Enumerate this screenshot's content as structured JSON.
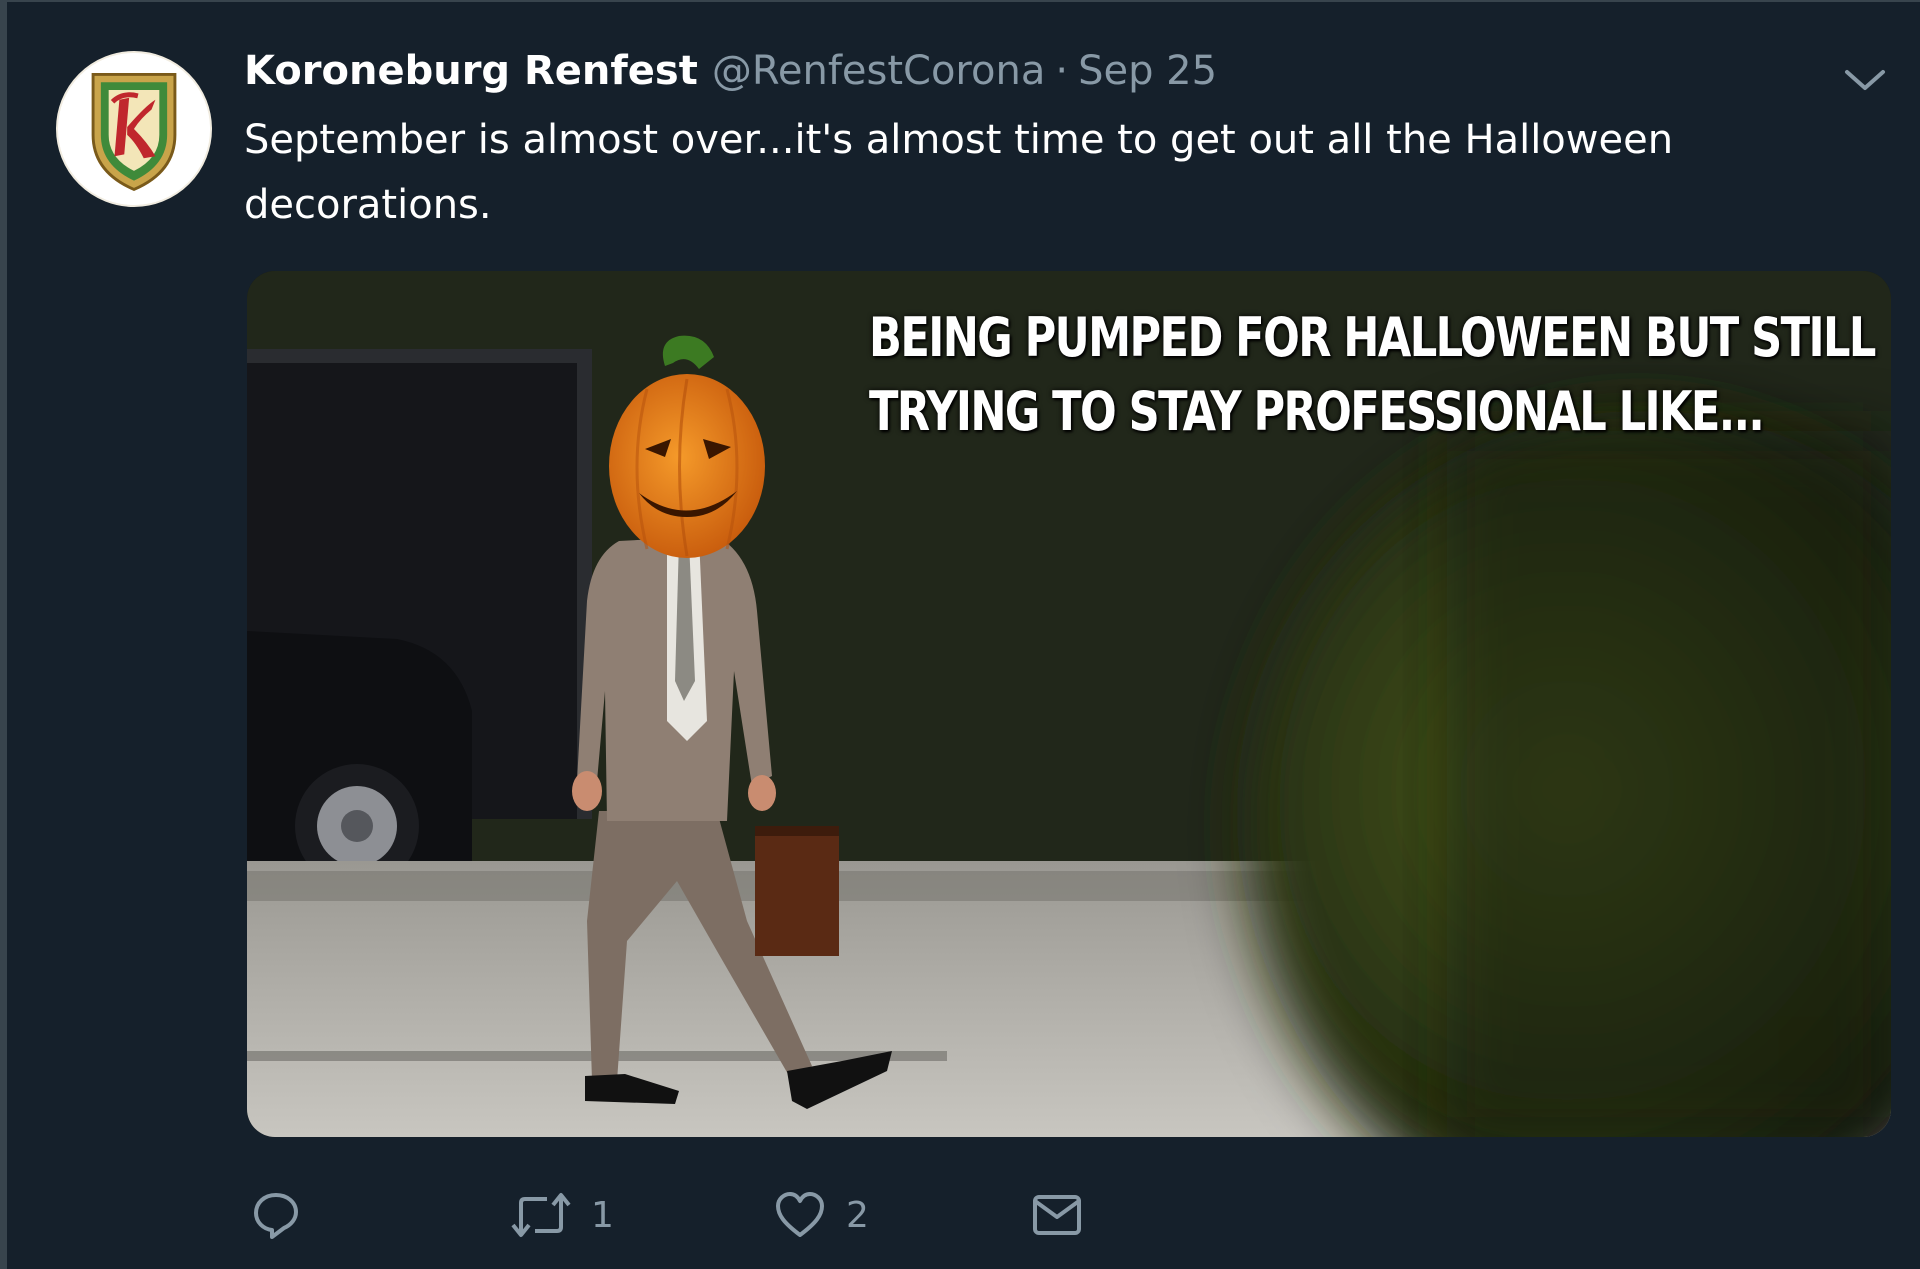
{
  "tweet": {
    "display_name": "Koroneburg Renfest",
    "handle": "@RenfestCorona",
    "separator": "·",
    "timestamp": "Sep 25",
    "text": "September is almost over...it's almost time to get out all the Halloween decorations.",
    "media": {
      "caption": "BEING PUMPED FOR HALLOWEEN BUT STILL TRYING TO STAY PROFESSIONAL LIKE..."
    },
    "actions": {
      "reply_icon": "reply-icon",
      "retweet_icon": "retweet-icon",
      "retweet_count": "1",
      "like_icon": "heart-icon",
      "like_count": "2",
      "dm_icon": "envelope-icon"
    },
    "colors": {
      "background": "#15202b",
      "secondary_text": "#8899a6",
      "primary_text": "#ffffff"
    }
  }
}
